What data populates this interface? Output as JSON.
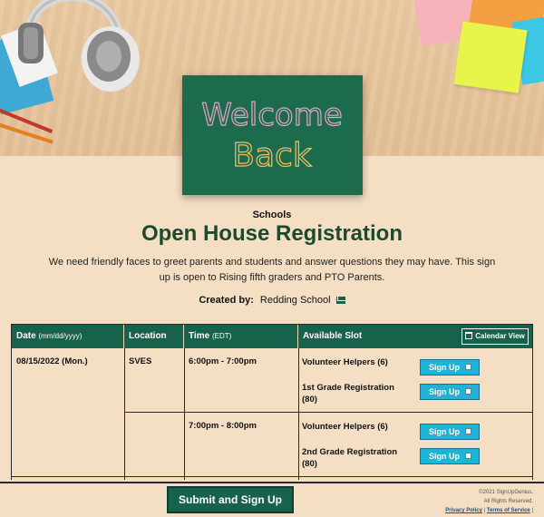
{
  "hero": {
    "chalkboard_line1": "Welcome",
    "chalkboard_line2": "Back"
  },
  "header": {
    "category": "Schools",
    "title": "Open House Registration",
    "description": "We need friendly faces to greet parents and students and answer questions they may have. This sign up is open to Rising fifth graders and PTO Parents.",
    "created_by_label": "Created by:",
    "created_by_name": "Redding School"
  },
  "table": {
    "headers": {
      "date": "Date",
      "date_sub": "(mm/dd/yyyy)",
      "location": "Location",
      "time": "Time",
      "time_sub": "(EDT)",
      "slot": "Available Slot"
    },
    "calendar_view_label": "Calendar View",
    "rows": [
      {
        "date": "08/15/2022 (Mon.)",
        "location": "SVES",
        "time": "6:00pm - 7:00pm",
        "slots": [
          {
            "name": "Volunteer Helpers (6)",
            "button": "Sign Up"
          },
          {
            "name": "1st Grade Registration (80)",
            "button": "Sign Up"
          }
        ]
      },
      {
        "date": "",
        "location": "",
        "time": "7:00pm - 8:00pm",
        "slots": [
          {
            "name": "Volunteer Helpers (6)",
            "button": "Sign Up"
          },
          {
            "name": "2nd Grade Registration (80)",
            "button": "Sign Up"
          }
        ]
      }
    ]
  },
  "footer": {
    "submit_label": "Submit and Sign Up",
    "copyright": "©2021 SignUpGenius.",
    "rights": "All Rights Reserved.",
    "privacy": "Privacy Policy",
    "separator": "|",
    "terms": "Terms of Service",
    "trailing_sep": "|"
  },
  "colors": {
    "accent": "#16624a",
    "button": "#1fb3d8",
    "background": "#f5dfc4"
  }
}
